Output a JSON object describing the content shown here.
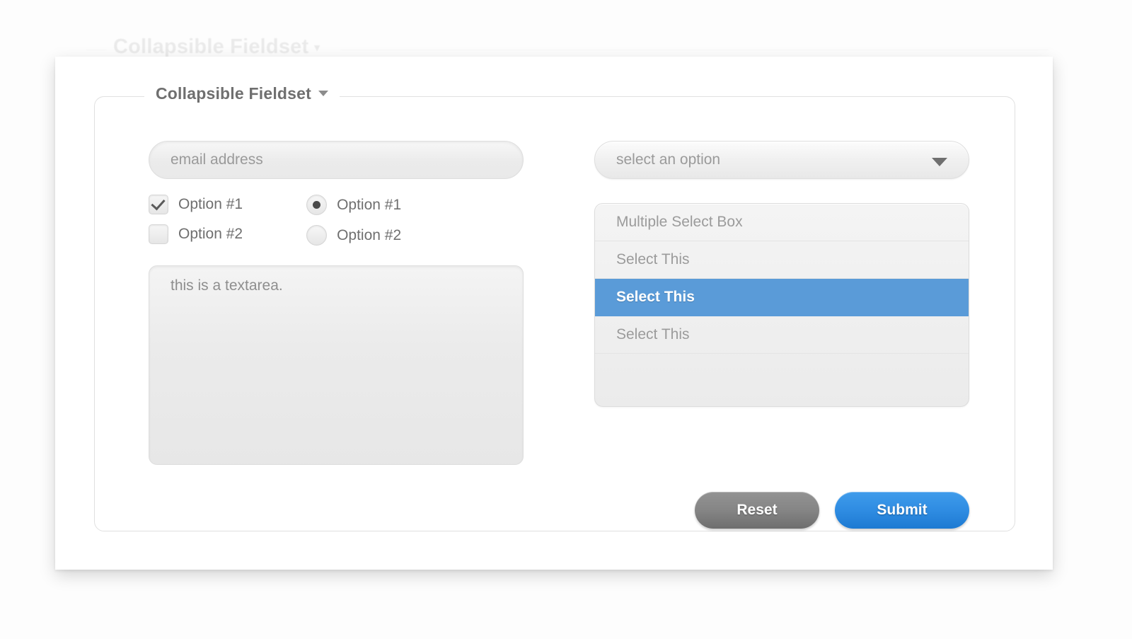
{
  "ghost": {
    "legend": "Collapsible Fieldset",
    "caret": "collapse-caret-icon"
  },
  "fieldset": {
    "legend": "Collapsible Fieldset",
    "caret_icon": "chevron-down-icon"
  },
  "left": {
    "email": {
      "placeholder": "email address",
      "value": ""
    },
    "checkboxes": [
      {
        "label": "Option #1",
        "checked": true
      },
      {
        "label": "Option #2",
        "checked": false
      }
    ],
    "radios": [
      {
        "label": "Option #1",
        "checked": true
      },
      {
        "label": "Option #2",
        "checked": false
      }
    ],
    "textarea": {
      "value": "this is a textarea."
    }
  },
  "right": {
    "select": {
      "value": "select an option",
      "arrow_icon": "triangle-down-icon"
    },
    "multiselect": {
      "options": [
        {
          "label": "Multiple Select Box",
          "selected": false
        },
        {
          "label": "Select This",
          "selected": false
        },
        {
          "label": "Select This",
          "selected": true
        },
        {
          "label": "Select This",
          "selected": false
        },
        {
          "label": "",
          "selected": false
        }
      ]
    }
  },
  "buttons": {
    "reset": "Reset",
    "submit": "Submit"
  },
  "colors": {
    "highlight": "#5a9bd8",
    "submit": "#2f8ce2",
    "reset": "#858585",
    "text": "#6f6f6f",
    "placeholder": "#9a9a9a"
  }
}
